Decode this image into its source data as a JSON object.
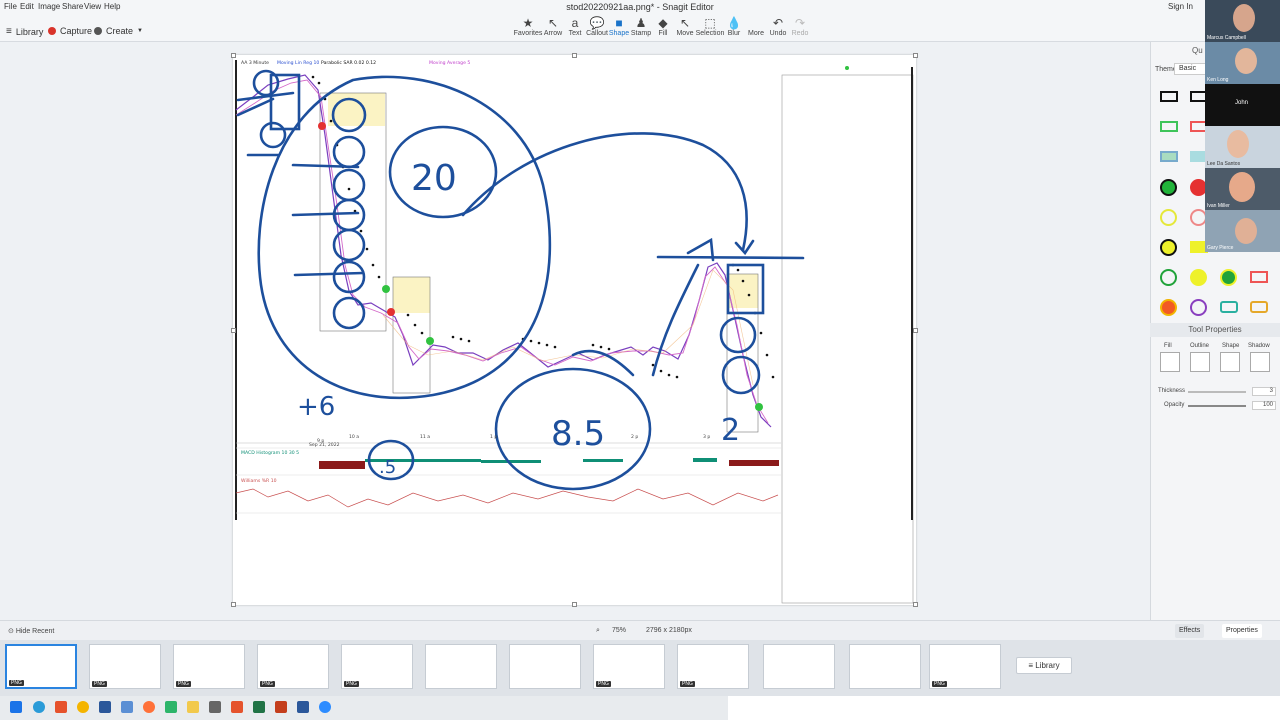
{
  "menu": [
    "File",
    "Edit",
    "Image",
    "Share",
    "View",
    "Help"
  ],
  "window_title": "stod20220921aa.png* - Snagit Editor",
  "signin_label": "Sign In",
  "toolbar": {
    "library_label": "Library",
    "capture_label": "Capture",
    "create_label": "Create",
    "tools": [
      {
        "label": "Favorites",
        "icon": "star-icon"
      },
      {
        "label": "Arrow",
        "icon": "arrow-icon"
      },
      {
        "label": "Text",
        "icon": "text-icon"
      },
      {
        "label": "Callout",
        "icon": "callout-icon"
      },
      {
        "label": "Shape",
        "icon": "shape-icon"
      },
      {
        "label": "Stamp",
        "icon": "stamp-icon"
      },
      {
        "label": "Fill",
        "icon": "fill-icon"
      },
      {
        "label": "Move",
        "icon": "move-icon"
      },
      {
        "label": "Selection",
        "icon": "selection-icon"
      },
      {
        "label": "Blur",
        "icon": "blur-icon"
      },
      {
        "label": "More",
        "icon": "more-icon"
      },
      {
        "label": "Undo",
        "icon": "undo-icon"
      },
      {
        "label": "Redo",
        "icon": "redo-icon"
      }
    ],
    "active_tool": "Shape"
  },
  "chart_header": {
    "legend_items": [
      "AA 3 Minute",
      "Moving Lin Reg 10",
      "Parabolic SAR 0.02 0.12",
      "Moving Average 5"
    ],
    "date_label": "Sep 21, 2022",
    "time_ticks": [
      "9 p",
      "10 a",
      "11 a",
      "1 p",
      "2 p",
      "3 p"
    ],
    "macd_label": "MACD Histogram 10 30 5",
    "williams_label": "Williams %R 10"
  },
  "annotations": {
    "number_20": "20",
    "number_plus6": "+6",
    "number_85": "8.5",
    "number_2": "2",
    "number_dot5": ".5"
  },
  "right_panel": {
    "header": "Qu",
    "theme_label": "Theme:",
    "theme_value": "Basic",
    "tool_properties_label": "Tool Properties",
    "fill_label": "Fill",
    "outline_label": "Outline",
    "shape_label": "Shape",
    "shadow_label": "Shadow",
    "thickness_label": "Thickness",
    "thickness_value": "3",
    "opacity_label": "Opacity",
    "opacity_value": "100"
  },
  "video_participants": [
    {
      "name": "Marcus Campbell"
    },
    {
      "name": "Ken Long"
    },
    {
      "name": "John"
    },
    {
      "name": "Lee Da Santos"
    },
    {
      "name": "Ivan Miller"
    },
    {
      "name": "Gary Pierce"
    }
  ],
  "statusbar": {
    "hide_recent_label": "Hide Recent",
    "zoom": "75%",
    "dimensions": "2796 x 2180px",
    "effects_label": "Effects",
    "properties_label": "Properties"
  },
  "tray": {
    "library_label": "Library",
    "thumb_badge": "PNG"
  },
  "colors": {
    "ink_blue": "#1d4f9c",
    "accent": "#2a84e0"
  }
}
